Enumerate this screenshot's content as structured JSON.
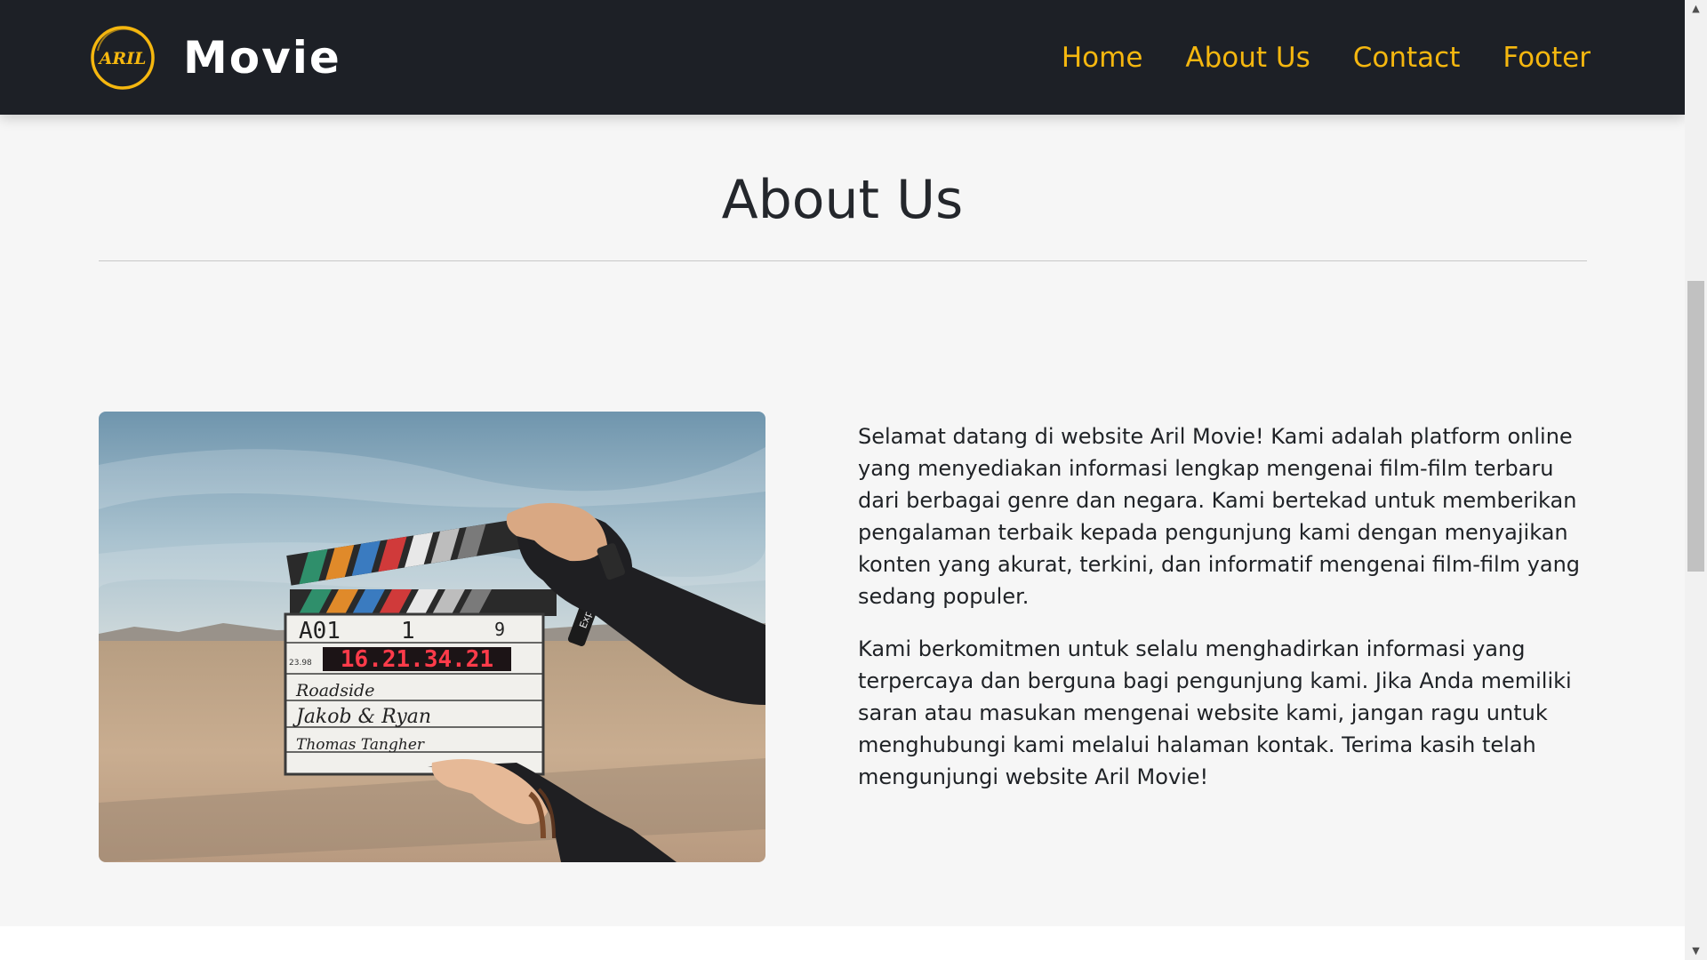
{
  "navbar": {
    "logo_text": "ARIL",
    "brand_name": "Movie",
    "links": [
      "Home",
      "About Us",
      "Contact",
      "Footer"
    ]
  },
  "about": {
    "title": "About Us",
    "image": {
      "alt": "",
      "clapper_timecode": "16.21.34.21",
      "clapper_scene": "A01",
      "clapper_take": "1",
      "clapper_roll": "9",
      "clapper_fps": "23.98",
      "clapper_production": "Roadside",
      "clapper_director": "Jakob & Ryan",
      "clapper_camera": "Thomas Tangher",
      "marker_brand": "Expo"
    },
    "paragraphs": [
      "Selamat datang di website Aril Movie! Kami adalah platform online yang menyediakan informasi lengkap mengenai film-film terbaru dari berbagai genre dan negara. Kami bertekad untuk memberikan pengalaman terbaik kepada pengunjung kami dengan menyajikan konten yang akurat, terkini, dan informatif mengenai film-film yang sedang populer.",
      "Kami berkomitmen untuk selalu menghadirkan informasi yang terpercaya dan berguna bagi pengunjung kami. Jika Anda memiliki saran atau masukan mengenai website kami, jangan ragu untuk menghubungi kami melalui halaman kontak. Terima kasih telah mengunjungi website Aril Movie!"
    ]
  },
  "colors": {
    "navbar_bg": "#1d2026",
    "accent": "#f5b70f",
    "section_bg": "#f6f6f6",
    "text": "#1f2226"
  },
  "icons": {
    "logo": "aril-circle-logo-icon",
    "scroll_up": "triangle-up-icon",
    "scroll_down": "triangle-down-icon"
  }
}
